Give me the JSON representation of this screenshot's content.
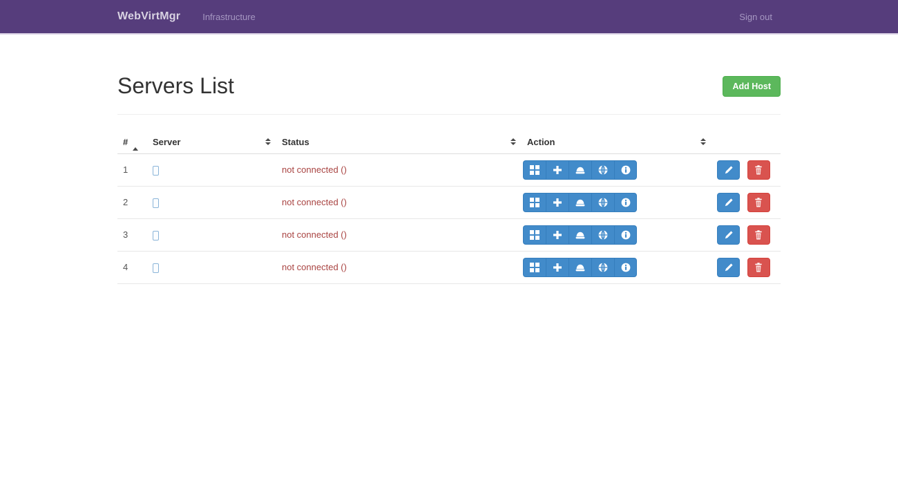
{
  "navbar": {
    "brand": "WebVirtMgr",
    "infrastructure": "Infrastructure",
    "sign_out": "Sign out"
  },
  "page": {
    "title": "Servers List",
    "add_host_label": "Add Host"
  },
  "table": {
    "headers": [
      {
        "label": "#",
        "sort": "asc"
      },
      {
        "label": "Server",
        "sort": "both"
      },
      {
        "label": "Status",
        "sort": "both"
      },
      {
        "label": "Action",
        "sort": "both"
      },
      {
        "label": "",
        "sort": "none"
      }
    ],
    "rows": [
      {
        "num": "1",
        "server": "",
        "status": "not connected ()"
      },
      {
        "num": "2",
        "server": "",
        "status": "not connected ()"
      },
      {
        "num": "3",
        "server": "",
        "status": "not connected ()"
      },
      {
        "num": "4",
        "server": "",
        "status": "not connected ()"
      }
    ],
    "action_buttons": [
      "overview",
      "new-instance",
      "storage",
      "network",
      "host-info"
    ],
    "row_buttons": [
      "edit",
      "delete"
    ]
  },
  "colors": {
    "navbar_bg": "#563d7c",
    "primary_button": "#428bca",
    "danger_button": "#d9534f",
    "success_button": "#5cb85c",
    "status_text": "#a94442"
  }
}
